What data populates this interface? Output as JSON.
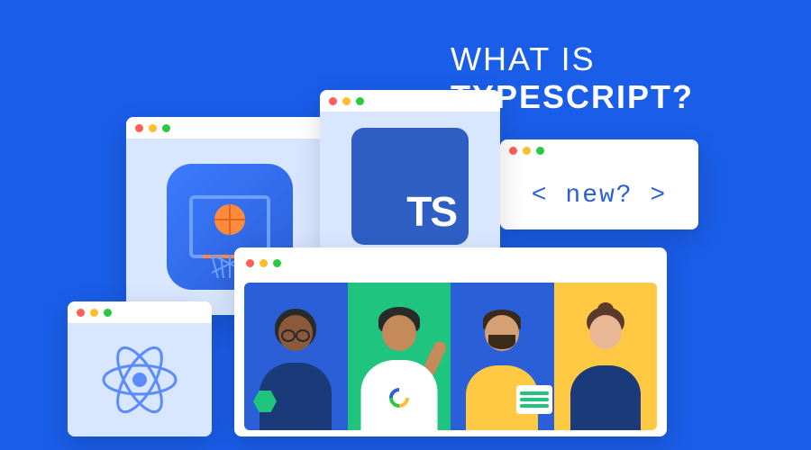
{
  "headline": {
    "line1": "WHAT IS",
    "line2": "TYPESCRIPT?"
  },
  "windows": {
    "ts_logo_text": "TS",
    "code_snippet": "< new? >"
  }
}
